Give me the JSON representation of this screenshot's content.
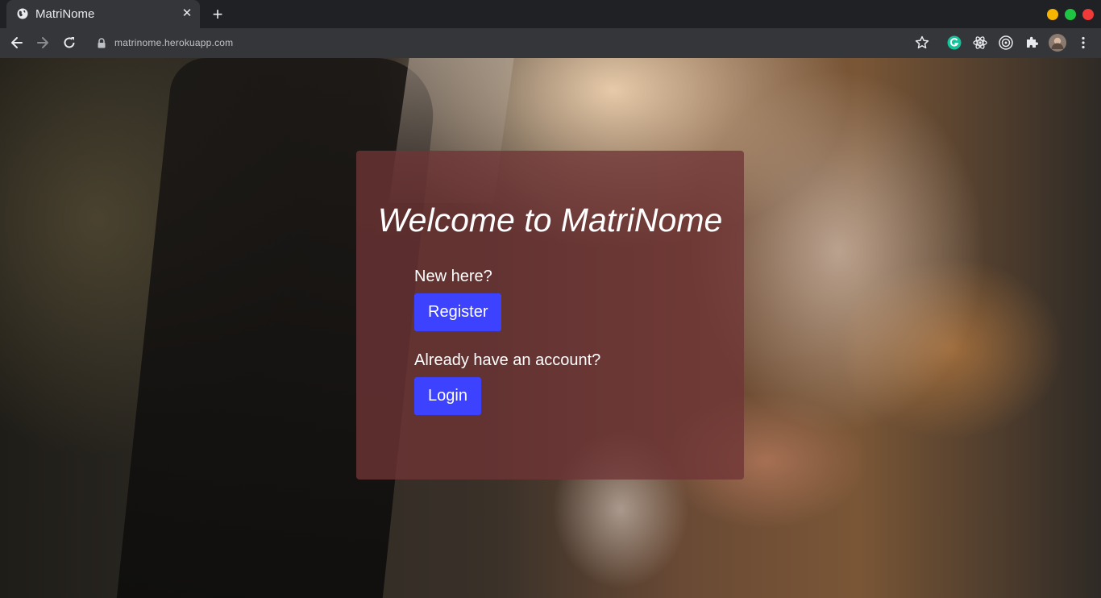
{
  "browser": {
    "tab_title": "MatriNome",
    "tab_close": "✕",
    "new_tab": "+",
    "url": "matrinome.herokuapp.com",
    "window_buttons": [
      {
        "name": "minimize",
        "color": "#f5b400"
      },
      {
        "name": "maximize",
        "color": "#1fc443"
      },
      {
        "name": "close",
        "color": "#f03a3a"
      }
    ],
    "extensions": [
      "grammarly-icon",
      "react-devtools-icon",
      "extension-target-icon",
      "puzzle-icon",
      "profile-avatar"
    ]
  },
  "page": {
    "heading": "Welcome to MatriNome",
    "register_prompt": "New here?",
    "register_label": "Register",
    "login_prompt": "Already have an account?",
    "login_label": "Login"
  },
  "colors": {
    "button": "#3d42ff",
    "card": "#703436"
  }
}
